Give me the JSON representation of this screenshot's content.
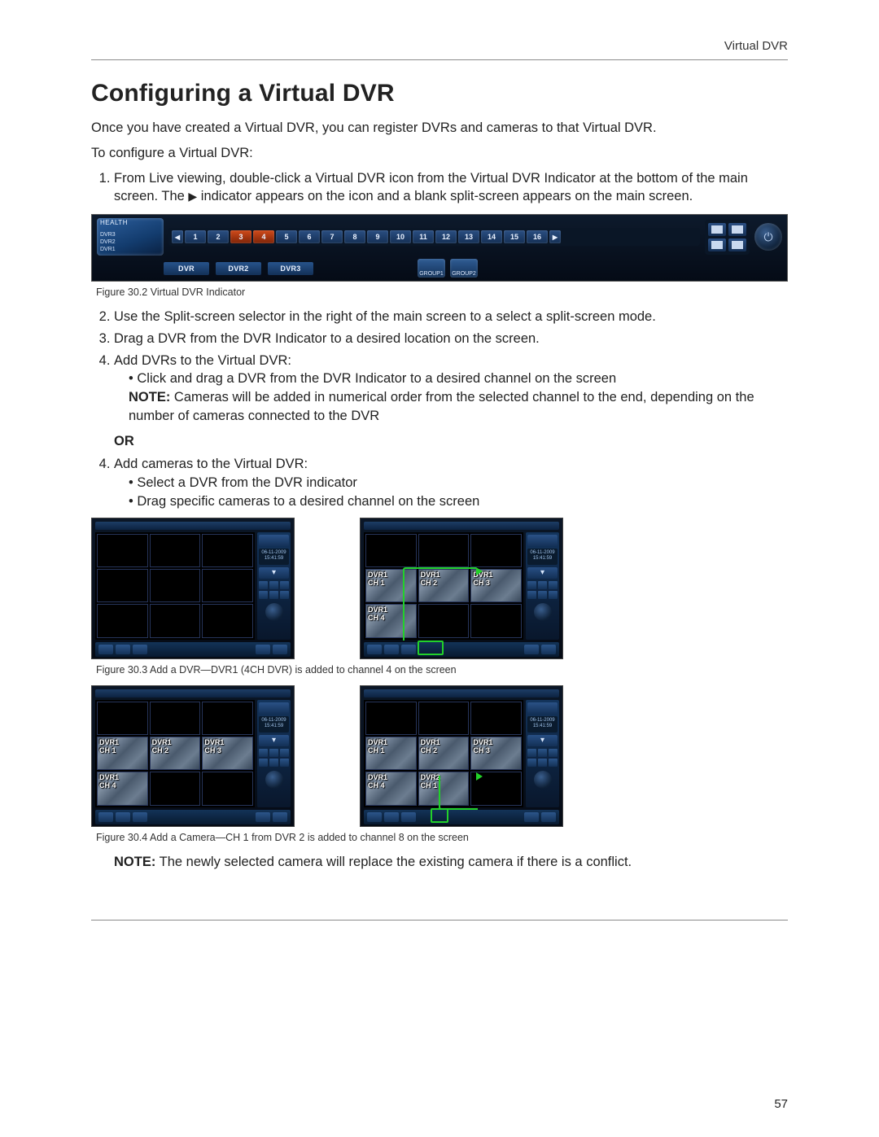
{
  "running_head": "Virtual DVR",
  "title": "Configuring a Virtual DVR",
  "intro_p1": "Once you have created a Virtual DVR, you can register DVRs and cameras to that Virtual DVR.",
  "intro_p2": "To configure a Virtual DVR:",
  "step1_a": "From Live viewing, double-click a Virtual DVR icon from the Virtual DVR Indicator at the bottom of the main screen. The ",
  "step1_b": " indicator appears on the icon and a blank split-screen appears on the main screen.",
  "play_glyph": "▶",
  "fig302_caption": "Figure 30.2 Virtual DVR Indicator",
  "step2": "Use the Split-screen selector in the right of the main screen to a select a split-screen mode.",
  "step3": "Drag a DVR from the DVR Indicator to a desired location on the screen.",
  "step4a": "Add DVRs to the Virtual DVR:",
  "step4a_b1": "• Click and drag a DVR from the DVR Indicator to a desired channel on the screen",
  "note1_label": "NOTE:",
  "note1_body": " Cameras will be added in numerical order from the selected channel to the end, depending on the number of cameras connected to the DVR",
  "or_label": "OR",
  "step4b": "Add cameras to the Virtual DVR:",
  "step4b_b1": "• Select a DVR from the DVR indicator",
  "step4b_b2": "• Drag specific cameras to a desired channel on the screen",
  "fig303_caption": "Figure 30.3 Add a DVR—DVR1 (4CH DVR) is added to channel 4 on the screen",
  "fig304_caption": "Figure 30.4 Add a Camera—CH 1 from DVR 2 is added to channel 8 on the screen",
  "note2_label": "NOTE:",
  "note2_body": " The newly selected camera will replace the existing camera if there is a conflict.",
  "pagenum": "57",
  "bar": {
    "health_label": "HEALTH",
    "health_lines": "DVR3\nDVR2\nDVR1",
    "arrow_left": "◀",
    "arrow_right": "▶",
    "numbers": [
      "1",
      "2",
      "3",
      "4",
      "5",
      "6",
      "7",
      "8",
      "9",
      "10",
      "11",
      "12",
      "13",
      "14",
      "15",
      "16"
    ],
    "red_indices": [
      2,
      3
    ],
    "dvr_tabs": [
      "DVR",
      "DVR2",
      "DVR3"
    ],
    "groups": [
      "GROUP1",
      "GROUP2"
    ],
    "power_glyph": "⏻",
    "power_label": "POWER"
  },
  "fig303r_labels": {
    "c1": "DVR1\nCH 1",
    "c2": "DVR1\nCH 2",
    "c3": "DVR1\nCH 3",
    "c4": "DVR1\nCH 4"
  },
  "fig304l_labels": {
    "c1": "DVR1\nCH 1",
    "c2": "DVR1\nCH 2",
    "c3": "DVR1\nCH 3",
    "c4": "DVR1\nCH 4"
  },
  "fig304r_labels": {
    "c1": "DVR1\nCH 1",
    "c2": "DVR1\nCH 2",
    "c3": "DVR1\nCH 3",
    "c4": "DVR1\nCH 4",
    "c5": "DVR2\nCH 1"
  },
  "side_time": "06-11-2009\n15:41:59"
}
